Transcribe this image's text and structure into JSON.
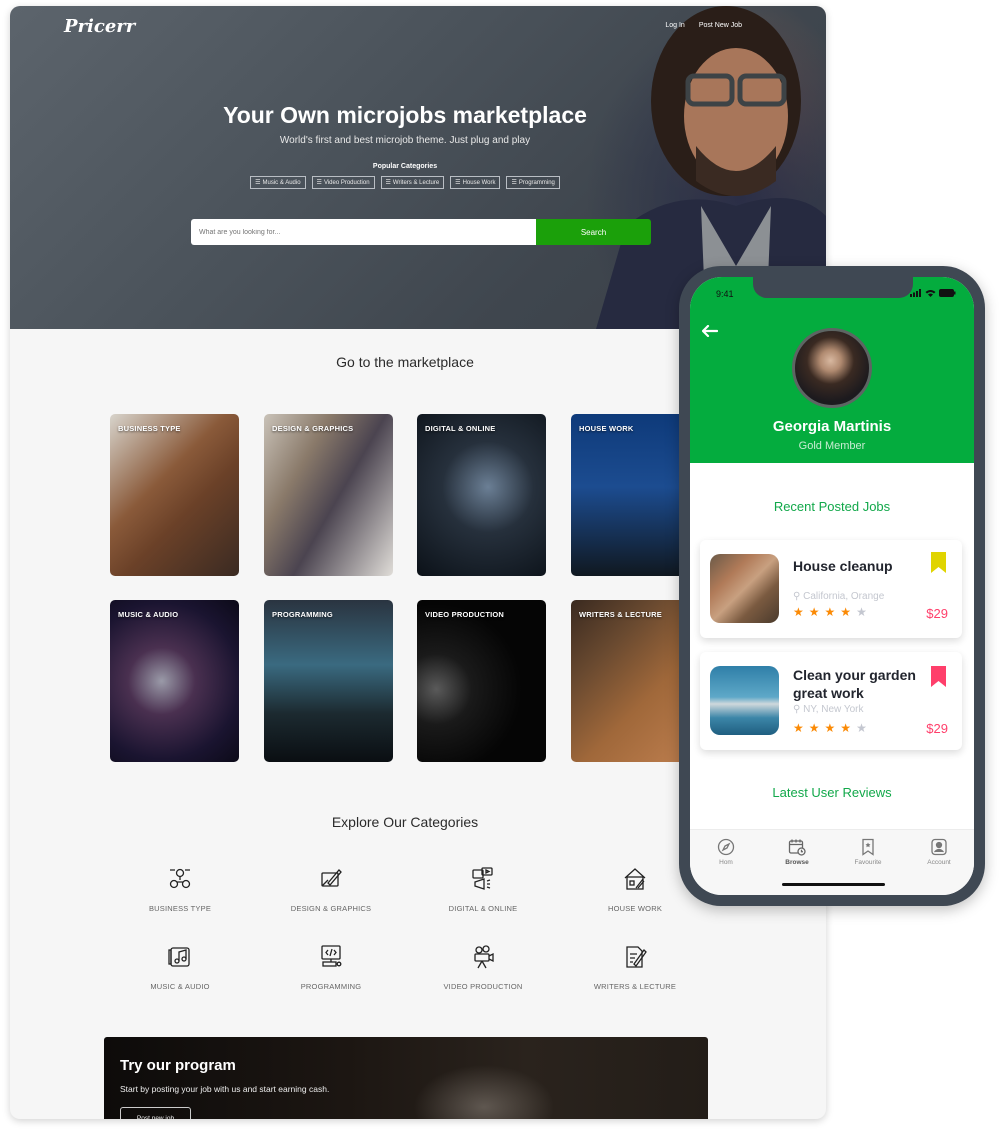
{
  "site": {
    "logo": "Pricerr",
    "nav": [
      {
        "label": "Log In"
      },
      {
        "label": "Post New Job"
      }
    ],
    "hero": {
      "title": "Your Own microjobs marketplace",
      "subtitle": "World's first and best microjob theme. Just plug and play",
      "popular_label": "Popular Categories",
      "popular_tags": [
        {
          "label": "Music & Audio",
          "icon": "list-icon"
        },
        {
          "label": "Video Production",
          "icon": "list-icon"
        },
        {
          "label": "Writers & Lecture",
          "icon": "list-icon"
        },
        {
          "label": "House Work",
          "icon": "list-icon"
        },
        {
          "label": "Programming",
          "icon": "list-icon"
        }
      ],
      "search": {
        "placeholder": "What are you looking for...",
        "value": "",
        "button_label": "Search"
      }
    },
    "marketplace": {
      "title": "Go to the marketplace",
      "cards": [
        {
          "label": "BUSINESS TYPE"
        },
        {
          "label": "DESIGN & GRAPHICS"
        },
        {
          "label": "DIGITAL & ONLINE"
        },
        {
          "label": "HOUSE WORK"
        },
        {
          "label": "MUSIC & AUDIO"
        },
        {
          "label": "PROGRAMMING"
        },
        {
          "label": "VIDEO PRODUCTION"
        },
        {
          "label": "WRITERS & LECTURE"
        }
      ]
    },
    "explore": {
      "title": "Explore Our Categories",
      "items": [
        {
          "label": "BUSINESS TYPE",
          "icon": "business-network-icon"
        },
        {
          "label": "DESIGN & GRAPHICS",
          "icon": "design-pencil-icon"
        },
        {
          "label": "DIGITAL & ONLINE",
          "icon": "megaphone-video-icon"
        },
        {
          "label": "HOUSE WORK",
          "icon": "house-tools-icon"
        },
        {
          "label": "MUSIC & AUDIO",
          "icon": "music-album-icon"
        },
        {
          "label": "PROGRAMMING",
          "icon": "code-monitor-icon"
        },
        {
          "label": "VIDEO PRODUCTION",
          "icon": "film-camera-icon"
        },
        {
          "label": "WRITERS & LECTURE",
          "icon": "document-pen-icon"
        }
      ]
    },
    "promo": {
      "title": "Try our program",
      "subtitle": "Start by posting your job with us and start earning cash.",
      "button_label": "Post new job"
    }
  },
  "phone": {
    "status_time": "9:41",
    "profile": {
      "name": "Georgia Martinis",
      "role": "Gold Member"
    },
    "recent_title": "Recent Posted Jobs",
    "jobs": [
      {
        "title": "House cleanup",
        "location": "California, Orange",
        "rating": 4,
        "rating_max": 5,
        "price": "$29",
        "bookmark_color": "#e0d400"
      },
      {
        "title": "Clean your garden great work",
        "location": "NY, New York",
        "rating": 4,
        "rating_max": 5,
        "price": "$29",
        "bookmark_color": "#ff3f6b"
      }
    ],
    "reviews_title": "Latest User Reviews",
    "tabs": [
      {
        "label": "Hom",
        "icon": "compass-icon",
        "active": false
      },
      {
        "label": "Browse",
        "icon": "calendar-clock-icon",
        "active": true
      },
      {
        "label": "Favourite",
        "icon": "bookmark-star-icon",
        "active": false
      },
      {
        "label": "Account",
        "icon": "user-icon",
        "active": false
      }
    ]
  },
  "colors": {
    "accent_green": "#1ba00a",
    "phone_green": "#04ac3e",
    "price_red": "#ff3f6b",
    "star_orange": "#fb8a05"
  }
}
